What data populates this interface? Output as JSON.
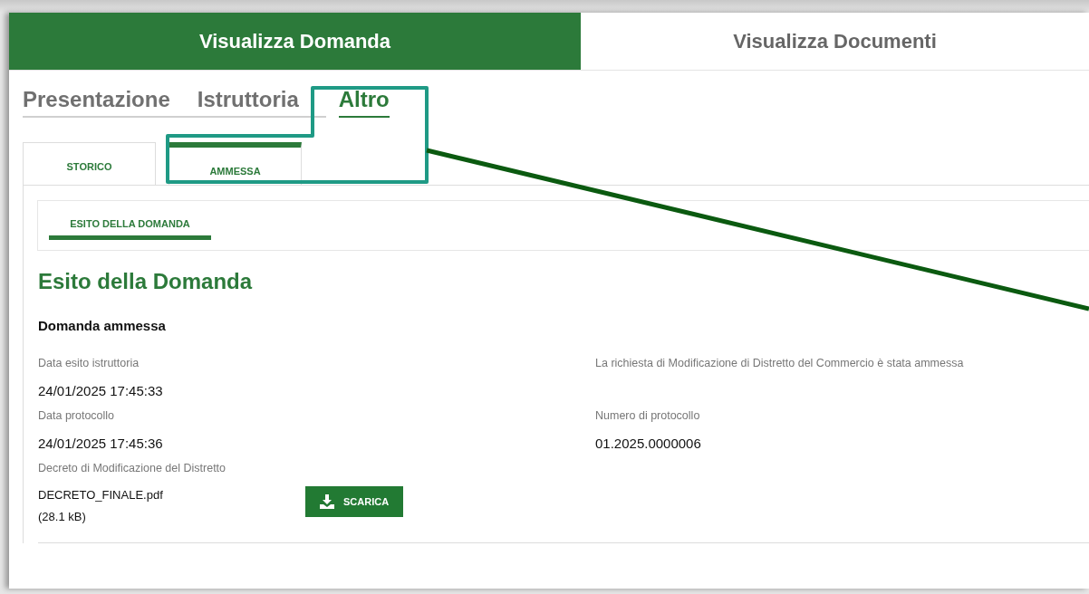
{
  "top_tabs": [
    {
      "label": "Visualizza Domanda",
      "selected": true
    },
    {
      "label": "Visualizza Documenti",
      "selected": false
    }
  ],
  "section_tabs": [
    {
      "label": "Presentazione",
      "selected": false
    },
    {
      "label": "Istruttoria",
      "selected": false
    },
    {
      "label": "Altro",
      "selected": true
    }
  ],
  "sub_tabs": [
    {
      "label": "STORICO",
      "selected": false
    },
    {
      "label": "AMMESSA",
      "selected": true
    }
  ],
  "inner_tabs": [
    {
      "label": "ESITO DELLA DOMANDA",
      "selected": true
    }
  ],
  "heading": "Esito della Domanda",
  "status": "Domanda ammessa",
  "fields": [
    {
      "label": "Data esito istruttoria",
      "value": "24/01/2025 17:45:33"
    },
    {
      "label": "La richiesta di Modificazione di Distretto del Commercio è stata ammessa"
    },
    {
      "label": "Data protocollo",
      "value": "24/01/2025 17:45:36"
    },
    {
      "label": "Numero di protocollo",
      "value": "01.2025.0000006"
    }
  ],
  "document": {
    "label": "Decreto di Modificazione del Distretto",
    "file_name": "DECRETO_FINALE.pdf",
    "file_size": "(28.1 kB)",
    "button": "SCARICA"
  }
}
